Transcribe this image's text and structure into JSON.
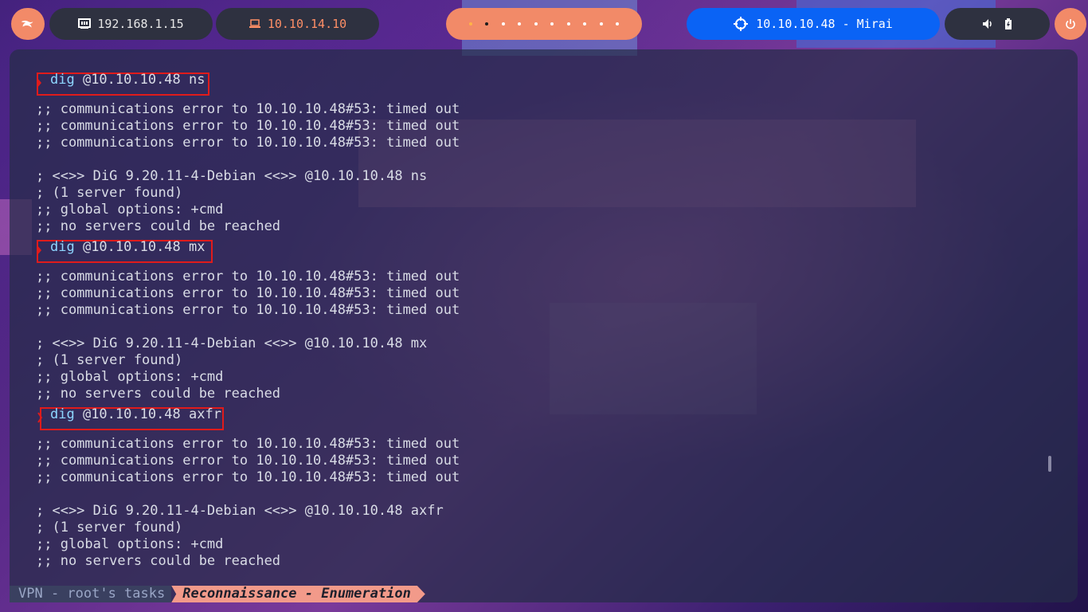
{
  "topbar": {
    "kali_icon": "kali-dragon-icon",
    "local_ip": "192.168.1.15",
    "vpn_ip": "10.10.14.10",
    "workspaces": [
      {
        "active": false,
        "highlight": true
      },
      {
        "active": true
      },
      {
        "active": false
      },
      {
        "active": false
      },
      {
        "active": false
      },
      {
        "active": false
      },
      {
        "active": false
      },
      {
        "active": false
      },
      {
        "active": false
      },
      {
        "active": false
      }
    ],
    "target": "10.10.10.48 - Mirai",
    "volume_icon": "speaker-icon",
    "battery_icon": "battery-charging-icon",
    "power_icon": "power-icon",
    "colors": {
      "accent": "#f28a68",
      "target_bg": "#0a63f5",
      "pill_bg": "#2e3140",
      "vpn_text": "#ff8f66"
    }
  },
  "terminal": {
    "commands": [
      {
        "cmd": "dig",
        "args": " @10.10.10.48 ns",
        "output": [
          ";; communications error to 10.10.10.48#53: timed out",
          ";; communications error to 10.10.10.48#53: timed out",
          ";; communications error to 10.10.10.48#53: timed out",
          "",
          "; <<>> DiG 9.20.11-4-Debian <<>> @10.10.10.48 ns",
          "; (1 server found)",
          ";; global options: +cmd",
          ";; no servers could be reached",
          ""
        ]
      },
      {
        "cmd": "dig",
        "args": " @10.10.10.48 mx",
        "output": [
          ";; communications error to 10.10.10.48#53: timed out",
          ";; communications error to 10.10.10.48#53: timed out",
          ";; communications error to 10.10.10.48#53: timed out",
          "",
          "; <<>> DiG 9.20.11-4-Debian <<>> @10.10.10.48 mx",
          "; (1 server found)",
          ";; global options: +cmd",
          ";; no servers could be reached",
          ""
        ]
      },
      {
        "cmd": "dig",
        "args": " @10.10.10.48 axfr",
        "output": [
          ";; communications error to 10.10.10.48#53: timed out",
          ";; communications error to 10.10.10.48#53: timed out",
          ";; communications error to 10.10.10.48#53: timed out",
          "",
          "; <<>> DiG 9.20.11-4-Debian <<>> @10.10.10.48 axfr",
          "; (1 server found)",
          ";; global options: +cmd",
          ";; no servers could be reached"
        ]
      }
    ]
  },
  "statusbar": {
    "left": "VPN - root's tasks",
    "right": "Reconnaissance - Enumeration"
  }
}
